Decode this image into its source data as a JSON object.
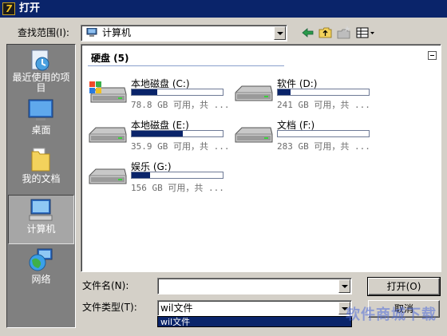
{
  "window": {
    "title": "打开",
    "logo_letter": "7"
  },
  "lookin": {
    "label": "查找范围(I):",
    "value": "计算机"
  },
  "toolbar": {
    "icons": [
      "back-arrow-icon",
      "up-folder-icon",
      "new-folder-icon",
      "view-menu-icon"
    ]
  },
  "places": [
    {
      "label": "最近使用的项目",
      "icon": "recent-items-icon"
    },
    {
      "label": "桌面",
      "icon": "desktop-icon"
    },
    {
      "label": "我的文档",
      "icon": "documents-folder-icon"
    },
    {
      "label": "计算机",
      "icon": "computer-icon",
      "selected": true
    },
    {
      "label": "网络",
      "icon": "network-globe-icon"
    }
  ],
  "filelist": {
    "group_title": "硬盘 (5)",
    "drives": [
      {
        "name": "本地磁盘 (C:)",
        "space": "78.8 GB 可用，共 ...",
        "usage": 0.28,
        "icon": "windows-system-drive-icon"
      },
      {
        "name": "软件 (D:)",
        "space": "241 GB 可用，共 ...",
        "usage": 0.14,
        "icon": "hard-drive-icon"
      },
      {
        "name": "本地磁盘 (E:)",
        "space": "35.9 GB 可用，共 ...",
        "usage": 0.56,
        "icon": "hard-drive-icon"
      },
      {
        "name": "文档 (F:)",
        "space": "283 GB 可用，共 ...",
        "usage": 0.0,
        "icon": "hard-drive-icon"
      },
      {
        "name": "娱乐 (G:)",
        "space": "156 GB 可用，共 ...",
        "usage": 0.2,
        "icon": "hard-drive-icon"
      }
    ]
  },
  "filename": {
    "label": "文件名(N):",
    "value": ""
  },
  "filetype": {
    "label": "文件类型(T):",
    "value": "wil文件",
    "dropdown_option": "wil文件"
  },
  "buttons": {
    "open": "打开(O)",
    "cancel": "取消"
  },
  "watermark": "软件商城下载"
}
